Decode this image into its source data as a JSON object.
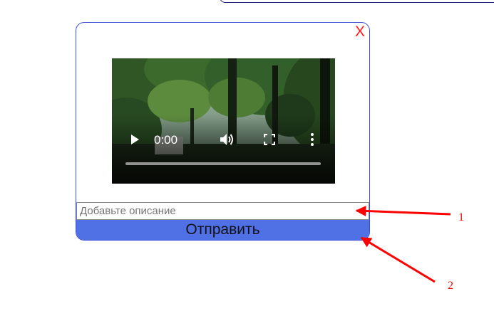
{
  "modal": {
    "close_label": "X",
    "description": {
      "placeholder": "Добавьте описание",
      "value": ""
    },
    "send_label": "Отправить"
  },
  "video": {
    "time": "0:00",
    "progress": 0,
    "icons": [
      "play-icon",
      "volume-icon",
      "fullscreen-icon",
      "more-options-icon"
    ]
  },
  "annotations": {
    "marker_1": "1",
    "marker_2": "2",
    "arrow_color": "#ff0000"
  },
  "colors": {
    "modal_border": "#3d4fd6",
    "send_button": "#5070e6",
    "close": "#ff1a1a"
  }
}
